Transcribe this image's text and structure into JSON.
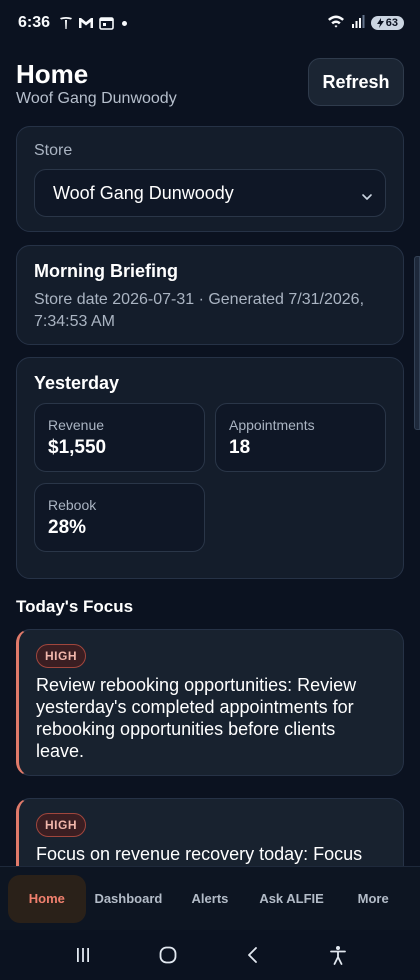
{
  "status_bar": {
    "time": "6:36",
    "battery": "63",
    "icons": [
      "tesla-icon",
      "gmail-icon",
      "calendar-icon",
      "notification-dot-icon",
      "wifi-icon",
      "signal-icon",
      "battery-charging-icon"
    ]
  },
  "header": {
    "title": "Home",
    "subtitle": "Woof Gang Dunwoody",
    "refresh_label": "Refresh"
  },
  "store": {
    "label": "Store",
    "selected": "Woof Gang Dunwoody"
  },
  "briefing": {
    "title": "Morning Briefing",
    "meta": "Store date 2026-07-31 · Generated 7/31/2026, 7:34:53 AM"
  },
  "yesterday": {
    "title": "Yesterday",
    "revenue_label": "Revenue",
    "revenue_value": "$1,550",
    "appointments_label": "Appointments",
    "appointments_value": "18",
    "rebook_label": "Rebook",
    "rebook_value": "28%"
  },
  "focus": {
    "heading": "Today's Focus",
    "items": [
      {
        "priority": "HIGH",
        "text": "Review rebooking opportunities: Review yesterday's completed appointments for rebooking opportunities before clients leave."
      },
      {
        "priority": "HIGH",
        "text": "Focus on revenue recovery today: Focus"
      }
    ]
  },
  "nav": {
    "items": [
      "Home",
      "Dashboard",
      "Alerts",
      "Ask ALFIE",
      "More"
    ],
    "active": "Home"
  },
  "colors": {
    "background": "#0b1220",
    "card": "#141d2b",
    "accent": "#f0806e",
    "priority_border": "#e07a6a"
  }
}
